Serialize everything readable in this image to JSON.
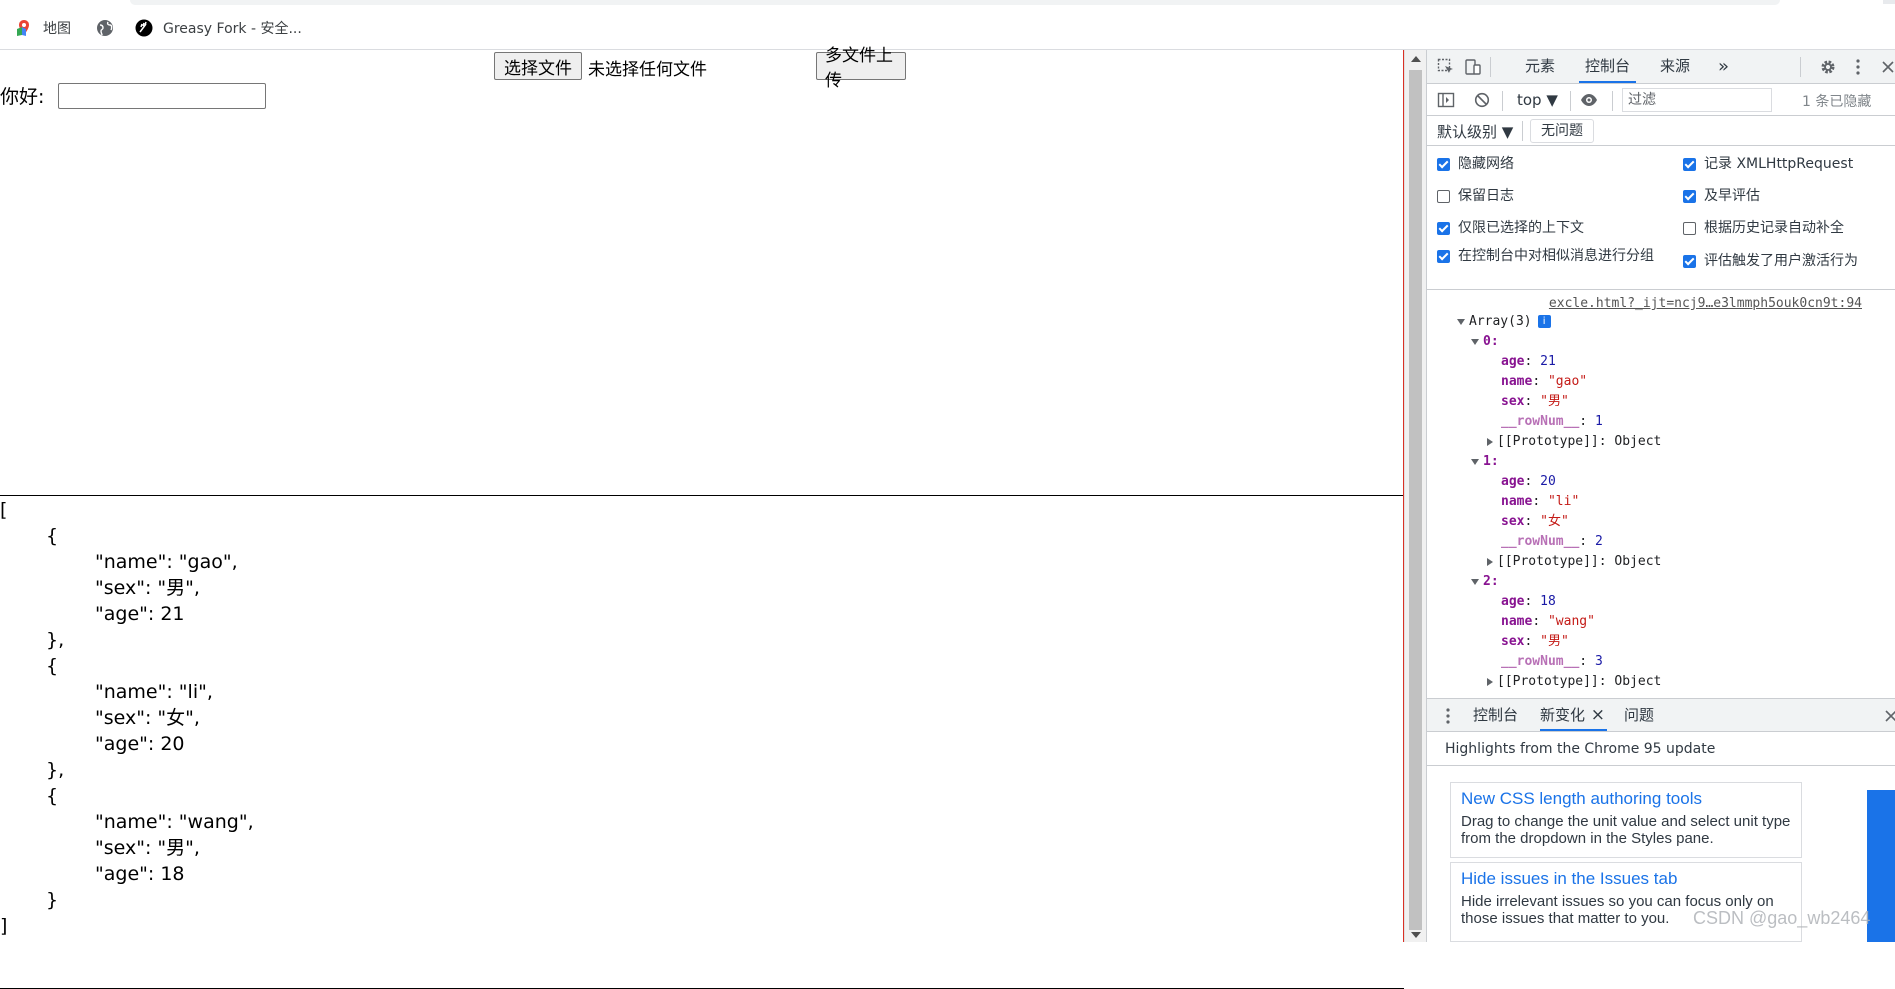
{
  "bookmarks": {
    "items": [
      {
        "label": "地图",
        "icon": "maps-icon"
      },
      {
        "label": "",
        "icon": "globe-icon"
      },
      {
        "label": "Greasy Fork - 安全...",
        "icon": "greasyfork-icon"
      }
    ]
  },
  "page": {
    "file_button": "选择文件",
    "file_status": "未选择任何文件",
    "upload_button": "多文件上传",
    "hello_label": "你好:",
    "hello_value": "",
    "json_lines": [
      "[",
      "{",
      "\"name\": \"gao\",",
      "\"sex\": \"男\",",
      "\"age\": 21",
      "},",
      "{",
      "\"name\": \"li\",",
      "\"sex\": \"女\",",
      "\"age\": 20",
      "},",
      "{",
      "\"name\": \"wang\",",
      "\"sex\": \"男\",",
      "\"age\": 18",
      "}",
      "]"
    ]
  },
  "devtools": {
    "tabs": [
      "元素",
      "控制台",
      "来源"
    ],
    "active_tab": "控制台",
    "more_tabs": "»",
    "context": "top ▼",
    "filter_placeholder": "过滤",
    "hidden_count": "1 条已隐藏",
    "level": "默认级别 ▼",
    "no_issues": "无问题",
    "settings": [
      {
        "label": "隐藏网络",
        "checked": true
      },
      {
        "label": "记录 XMLHttpRequest",
        "checked": true
      },
      {
        "label": "保留日志",
        "checked": false
      },
      {
        "label": "及早评估",
        "checked": true
      },
      {
        "label": "仅限已选择的上下文",
        "checked": true
      },
      {
        "label": "根据历史记录自动补全",
        "checked": false
      },
      {
        "label": "在控制台中对相似消息进行分组",
        "checked": true
      },
      {
        "label": "评估触发了用户激活行为",
        "checked": true
      }
    ],
    "console": {
      "source_link": "excle.html?_ijt=ncj9…e3lmmph5ouk0cn9t:94",
      "array_label": "Array(3)",
      "info_badge": "i",
      "items": [
        {
          "index": "0:",
          "age": "21",
          "name": "\"gao\"",
          "sex": "\"男\"",
          "rownum": "1",
          "proto": "[[Prototype]]: Object"
        },
        {
          "index": "1:",
          "age": "20",
          "name": "\"li\"",
          "sex": "\"女\"",
          "rownum": "2",
          "proto": "[[Prototype]]: Object"
        },
        {
          "index": "2:",
          "age": "18",
          "name": "\"wang\"",
          "sex": "\"男\"",
          "rownum": "3",
          "proto": "[[Prototype]]: Object"
        }
      ],
      "keys": {
        "age": "age",
        "name": "name",
        "sex": "sex",
        "rownum": "__rowNum__"
      }
    },
    "drawer": {
      "tabs": [
        "控制台",
        "新变化",
        "问题"
      ],
      "active_tab": "新变化",
      "close": "×",
      "header": "Highlights from the Chrome 95 update",
      "cards": [
        {
          "title": "New CSS length authoring tools",
          "desc": "Drag to change the unit value and select unit type from the dropdown in the Styles pane."
        },
        {
          "title": "Hide issues in the Issues tab",
          "desc": "Hide irrelevant issues so you can focus only on those issues that matter to you."
        }
      ]
    }
  },
  "watermark": "CSDN @gao_wb2464"
}
